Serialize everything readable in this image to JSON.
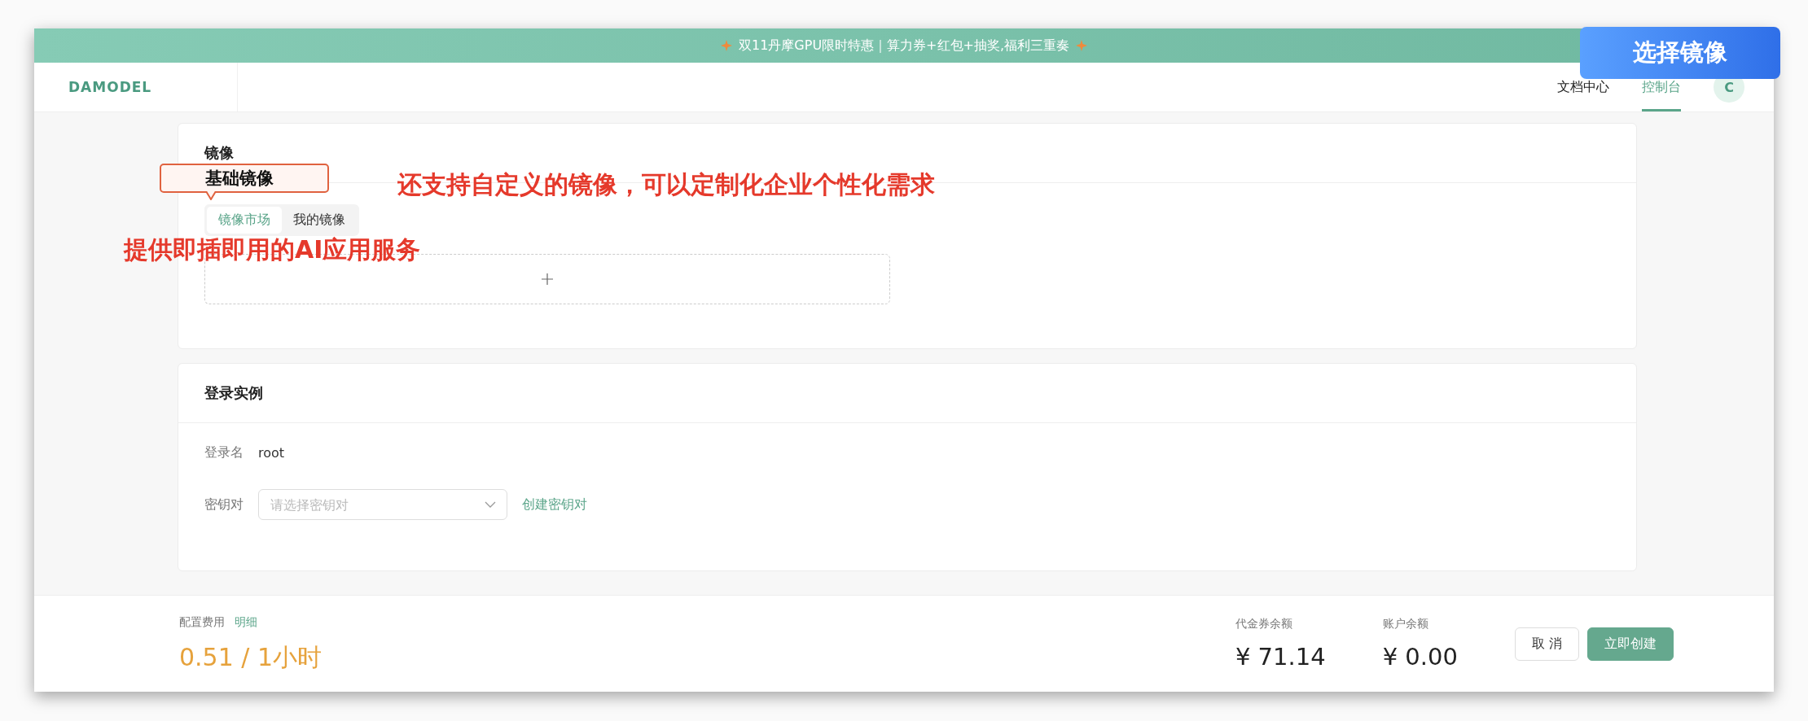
{
  "banner": {
    "text": "双11丹摩GPU限时特惠｜算力券+红包+抽奖,福利三重奏"
  },
  "header": {
    "logo": "DAMODEL",
    "nav": [
      {
        "label": "文档中心",
        "selected": false
      },
      {
        "label": "控制台",
        "selected": true
      }
    ],
    "avatar": "C"
  },
  "image_card": {
    "title": "镜像",
    "tabs": [
      {
        "label": "镜像市场",
        "selected": true
      },
      {
        "label": "我的镜像",
        "selected": false
      }
    ]
  },
  "login_card": {
    "title": "登录实例",
    "login_name": {
      "label": "登录名",
      "value": "root"
    },
    "key_pair": {
      "label": "密钥对",
      "placeholder": "请选择密钥对",
      "link": "创建密钥对"
    }
  },
  "footer": {
    "cost_label": "配置费用",
    "detail_link": "明细",
    "price": "0.51 / 1小时",
    "balances": [
      {
        "label": "代金券余额",
        "value": "¥ 71.14"
      },
      {
        "label": "账户余额",
        "value": "¥ 0.00"
      }
    ],
    "buttons": [
      {
        "label": "取 消",
        "kind": "secondary"
      },
      {
        "label": "立即创建",
        "kind": "primary"
      }
    ]
  },
  "annotations": {
    "badge": "选择镜像",
    "items": [
      {
        "kind": "callout",
        "text": "基础镜像"
      },
      {
        "kind": "note",
        "text": "还支持自定义的镜像，可以定制化企业个性化需求"
      },
      {
        "kind": "note",
        "text": "提供即插即用的AI应用服务"
      }
    ]
  }
}
